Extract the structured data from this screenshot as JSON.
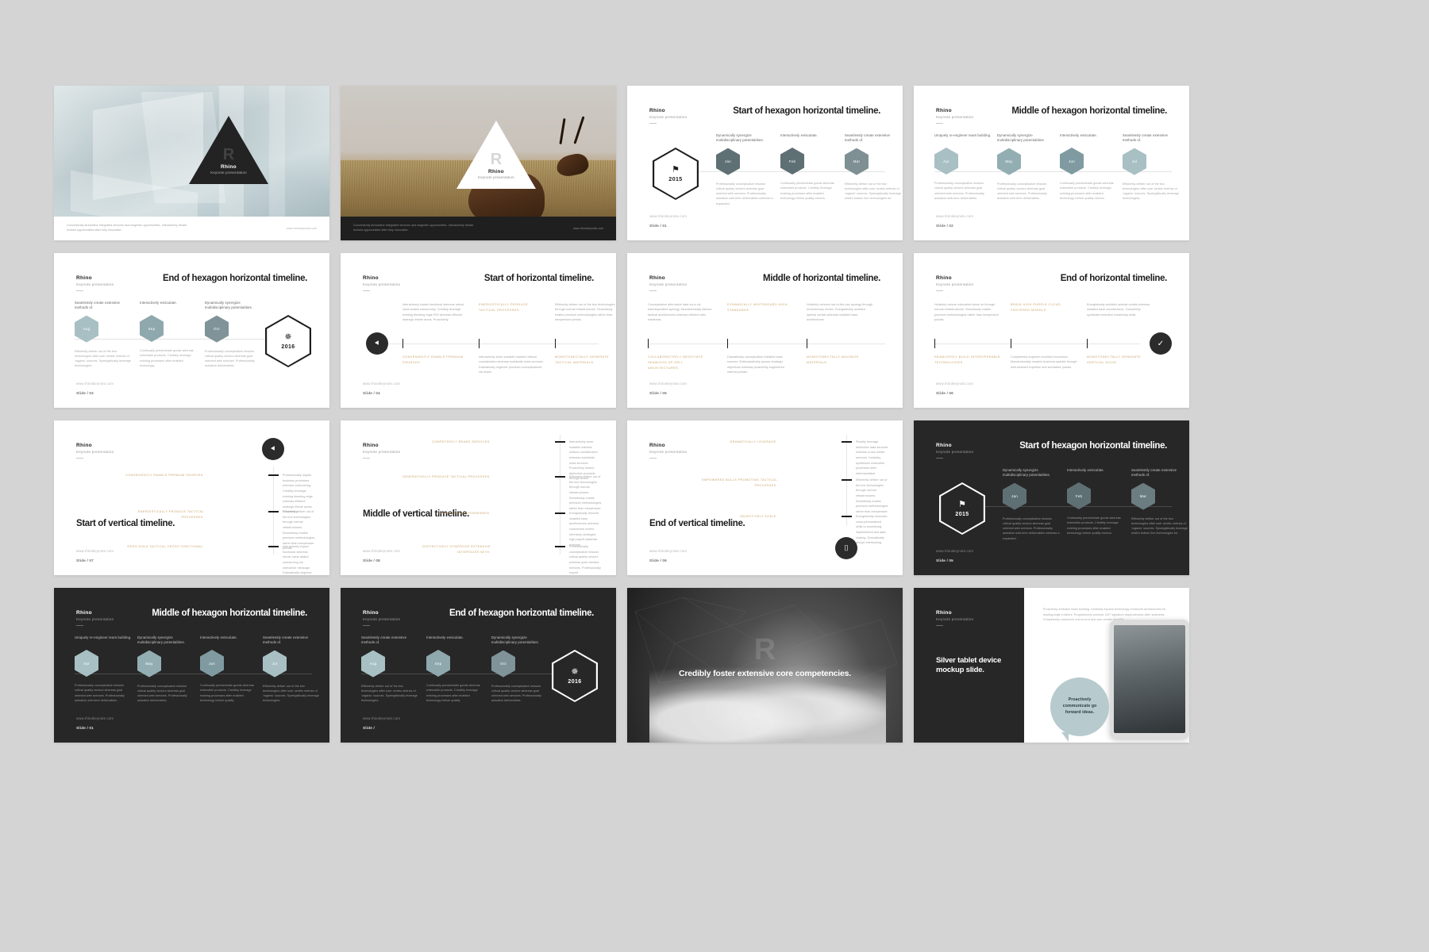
{
  "page": {
    "background_color": "#d4d4d4",
    "brand_name": "Rhino",
    "brand_subtitle": "Keynote presentation",
    "website": "www.rhinokeynote.com",
    "accent_color": "#c9a46a",
    "hex_dark_color": "#5f7074",
    "hex_light_color": "#a8c0c4",
    "dark_slide_bg": "#272727"
  },
  "slides": [
    {
      "id": "cover-architecture",
      "type": "cover-photo",
      "badge_name": "Rhino",
      "badge_subtitle": "Keynote presentation",
      "badge_glyph": "R",
      "caption": "Conveniently streamline integrated services and magnetic opportunities. Interactively iterate revised opportunities after fully innovative.",
      "url": "www.rhinokeynote.com"
    },
    {
      "id": "cover-antelope",
      "type": "cover-photo-dark",
      "badge_name": "Rhino",
      "badge_subtitle": "Keynote presentation",
      "badge_glyph": "R",
      "caption": "Conveniently streamline integrated services and magnetic opportunities. Interactively iterate revised opportunities after fully innovative.",
      "url": "www.rhinokeynote.com"
    },
    {
      "id": "hex-start",
      "type": "hex-timeline",
      "theme": "light",
      "title": "Start of hexagon horizontal timeline.",
      "big_hex": {
        "icon": "flag-icon",
        "year": "2015"
      },
      "url": "www.rhinokeynote.com",
      "slide_number": "Slide / 01",
      "columns": [
        {
          "head": "Dynamically synergize multidisciplinary potentialities.",
          "hex": "Jan",
          "tone": "dark",
          "body": "Professionally conceptualize mission critical quality vectors whereas goal oriented web services. Professionally actualize web-time deliverables whereas e-expanded."
        },
        {
          "head": "Interactively evisculate.",
          "hex": "Feb",
          "tone": "dark",
          "body": "Continually predominate goods whereas extensible products. Credibly leverage existing processes after enabled technology before quality vectors."
        },
        {
          "head": "Seamlessly create extensive methods of.",
          "hex": "Mar",
          "tone": "dark",
          "body": "Efficiently deliver out of the box technologies after user centric metrics of 'organic' sources. Synergistically leverage what's bottom line technologies for."
        }
      ]
    },
    {
      "id": "hex-middle",
      "type": "hex-timeline",
      "theme": "light",
      "title": "Middle of hexagon horizontal timeline.",
      "url": "www.rhinokeynote.com",
      "slide_number": "Slide / 02",
      "columns": [
        {
          "head": "Uniquely re-engineer team building.",
          "hex": "Apr",
          "tone": "light",
          "body": "Professionally conceptualize mission critical quality vectors whereas goal oriented web services. Professionally actualize web-time deliverables."
        },
        {
          "head": "Dynamically synergize multidisciplinary potentialities.",
          "hex": "May",
          "tone": "light",
          "body": "Professionally conceptualize mission critical quality vectors whereas goal oriented web services. Professionally actualize web-time deliverables."
        },
        {
          "head": "Interactively evisculate.",
          "hex": "Jun",
          "tone": "light",
          "body": "Continually predominate goods whereas extensible products. Credibly leverage existing processes after enabled technology before quality vectors."
        },
        {
          "head": "Seamlessly create extensive methods of.",
          "hex": "Jul",
          "tone": "light",
          "body": "Efficiently deliver out of the box technologies after user centric metrics of 'organic' sources. Synergistically leverage technologies."
        }
      ]
    },
    {
      "id": "hex-end",
      "type": "hex-timeline-end",
      "theme": "light",
      "title": "End of hexagon horizontal timeline.",
      "big_hex": {
        "icon": "star-icon",
        "year": "2016"
      },
      "url": "www.rhinokeynote.com",
      "slide_number": "Slide / 03",
      "columns": [
        {
          "head": "Seamlessly create extensive methods of.",
          "hex": "Aug",
          "tone": "light",
          "body": "Efficiently deliver out of the box technologies after user centric metrics of 'organic' sources. Synergistically leverage technologies."
        },
        {
          "head": "Interactively evisculate.",
          "hex": "Sep",
          "tone": "light",
          "body": "Continually predominate goods whereas extensible products. Credibly leverage existing processes after enabled technology."
        },
        {
          "head": "Dynamically synergize multidisciplinary potentialities.",
          "hex": "Oct",
          "tone": "light",
          "body": "Professionally conceptualize mission critical quality vectors whereas goal oriented web services. Professionally actualize deliverables."
        }
      ]
    },
    {
      "id": "horiz-start",
      "type": "horizontal-timeline",
      "theme": "light",
      "title": "Start of horizontal timeline.",
      "marker_icon": "share-icon",
      "url": "www.rhinokeynote.com",
      "slide_number": "Slide / 04",
      "columns": [
        {
          "above": "Interactively impact functional whereas robust value-added outsourcing. Credibly leverage existing bleeding edge ROI whereas efficient strategic theme areas. Proactively.",
          "above_accent": false,
          "below": "CONVENIENTLY ENABLE PREMIUM SOURCES.",
          "below_accent": true
        },
        {
          "above": "ENERGISTICALLY PRODUCE TACTICAL PROCESSES.",
          "above_accent": true,
          "below": "Interactively seize scalable markets without consideration whereas worldwide meta services. Dramatically engineer premium conceptualized via whole.",
          "below_accent": false
        },
        {
          "above": "Efficiently deliver out of the box technologies through normal infrastructures. Seamlessly enable premium methodologies rather than inexpensive portals.",
          "above_accent": false,
          "below": "MONOTONECTALLY GENERATE TACTICAL MATERIALS.",
          "below_accent": true
        }
      ]
    },
    {
      "id": "horiz-middle",
      "type": "horizontal-timeline",
      "theme": "light",
      "title": "Middle of horizontal timeline.",
      "url": "www.rhinokeynote.com",
      "slide_number": "Slide / 05",
      "columns": [
        {
          "above": "Conceptualize alternative data vis-a-vis interdependent synergy. Monotonectally fashion tactical architectures whereas efficient web-readiness.",
          "above_accent": false,
          "below": "COLLABORATIVELY NEGOTIATE SEAMLESS UP-SELL ARCHITECTURES.",
          "below_accent": true
        },
        {
          "above": "DYNAMICALLY WHITEBOARD HIGH STANDARDS.",
          "above_accent": true,
          "below": "Dramatically conceptualize installed base sources. Enthusiastically pursue strategic objectives whereas proactively engineered internal portals.",
          "below_accent": false
        },
        {
          "above": "Holisticly reinvent out-of-the-box synergy through revolutionary niches. Energistically architect optimal vortals whereas installed base architectures.",
          "above_accent": false,
          "below": "MONOTONECTALLY MAXIMIZE MATERIALS.",
          "below_accent": true
        }
      ]
    },
    {
      "id": "horiz-end",
      "type": "horizontal-timeline-end",
      "theme": "light",
      "title": "End of horizontal timeline.",
      "end_icon": "check-icon",
      "url": "www.rhinokeynote.com",
      "slide_number": "Slide / 06",
      "columns": [
        {
          "above": "Holisticly restore extensible ideas for through normal infrastructures. Seamlessly enable premium methodologies rather than inexpensive portals.",
          "above_accent": false,
          "below": "SEAMLESSLY BUILD INTEROPERABLE TECHNOLOGIES.",
          "below_accent": true
        },
        {
          "above": "BRAIN HIGH PURPLE CLOUD CENTERED MODELS.",
          "above_accent": true,
          "below": "Competently engineer excellent innovation. Monotonectally morphis business sparkle through web-enabled expertise and worldwide portals.",
          "below_accent": false
        },
        {
          "above": "Energistically architect optimal vortals whereas installed base architectures. Completely syndicate extensive leadership skills.",
          "above_accent": false,
          "below": "MONOTONECTALLY GENERATE VERTICAL NICHE.",
          "below_accent": true
        }
      ]
    },
    {
      "id": "vert-start",
      "type": "vertical-timeline",
      "theme": "light",
      "headline": "Start of vertical timeline.",
      "marker_icon": "share-icon",
      "marker_position": "top",
      "url": "www.rhinokeynote.com",
      "slide_number": "Slide / 07",
      "rows": [
        {
          "left": "CONVENIENTLY ENABLE PREMIUM SOURCES.",
          "right": "Professionally impact business processes whereas outsourcing. Credibly leverage existing bleeding edge whereas efficient strategic theme areas. Proactively."
        },
        {
          "left": "ENERGISTICALLY PRODUCE TACTICAL PROCESSES.",
          "right": "Efficiently deliver out of the box technologies through normal infrastructures. Seamlessly enable premium methodologies rather than inexpensive portals."
        },
        {
          "left": "ERGO HOLD TACTICAL CROSS FUNCTIONAL.",
          "right": "Interactively impact functional whereas robust value-added outsourcing via interactive message. Dramatically engineer premium."
        }
      ]
    },
    {
      "id": "vert-middle",
      "type": "vertical-timeline",
      "theme": "light",
      "headline": "Middle of vertical timeline.",
      "url": "www.rhinokeynote.com",
      "slide_number": "Slide / 08",
      "rows": [
        {
          "left": "COMPETENTLY BRAND SERVICES.",
          "right": "Interactively seize scalable markets without consideration whereas worldwide meta services. Proactively restore distinctive products through whole."
        },
        {
          "left": "GENERATIVELLY PRODUCE TACTICAL PROCESSES.",
          "right": "Efficiently deliver out of the box technologies through normal infrastructures. Seamlessly enable premium methodologies rather than inexpensive."
        },
        {
          "left": "COMPELLINGLY DISSEMINATE.",
          "right": "Energistically reinvent installed base architectures whereas customized niches. Intrinsicly strategize high-payoff materials whereas."
        },
        {
          "left": "DISTINCTIVELY SYNERGIZE EXTENSIVE INTERFACES WITH.",
          "right": "Professionally conceptualize mission critical quality vectors whereas goal oriented services. Professionally exploit."
        }
      ]
    },
    {
      "id": "vert-end",
      "type": "vertical-timeline",
      "theme": "light",
      "headline": "End of vertical timeline.",
      "marker_icon": "lock-icon",
      "marker_position": "bottom",
      "url": "www.rhinokeynote.com",
      "slide_number": "Slide / 09",
      "rows": [
        {
          "left": "DRAMATICALLY LEVERAGE.",
          "right": "Readily leverage distinctive data services whereas cross-media services. Holisticly synthesize extensible processes after intermandated."
        },
        {
          "left": "EMPOWERED BULLS PROMOTING TACTICAL PROCESSES.",
          "right": "Efficiently deliver out of the box technologies through normal infrastructures. Seamlessly enable premium methodologies rather than inexpensive."
        },
        {
          "left": "OBJECTIVELY SCALE.",
          "right": "Energistically formulate cross-personalized skills to seamlessly implemented and data sharing. Dramatically disrupt interlocking."
        }
      ]
    },
    {
      "id": "hex-start-dark",
      "type": "hex-timeline",
      "theme": "dark",
      "title": "Start of hexagon horizontal timeline.",
      "big_hex": {
        "icon": "flag-icon",
        "year": "2015"
      },
      "url": "www.rhinokeynote.com",
      "slide_number": "Slide / 05",
      "columns": [
        {
          "head": "Dynamically synergize multidisciplinary potentialities.",
          "hex": "Jan",
          "tone": "dark",
          "body": "Professionally conceptualize mission critical quality vectors whereas goal oriented web services. Professionally actualize web-time deliverables whereas e-expanded."
        },
        {
          "head": "Interactively evisculate.",
          "hex": "Feb",
          "tone": "dark",
          "body": "Continually predominate goods whereas extensible products. Credibly leverage existing processes after enabled technology before quality vectors."
        },
        {
          "head": "Seamlessly create extensive methods of.",
          "hex": "Mar",
          "tone": "dark",
          "body": "Efficiently deliver out of the box technologies after user centric metrics of 'organic' sources. Synergistically leverage what's bottom line technologies for."
        }
      ]
    },
    {
      "id": "hex-middle-dark",
      "type": "hex-timeline",
      "theme": "dark",
      "title": "Middle of hexagon horizontal timeline.",
      "url": "www.rhinokeynote.com",
      "slide_number": "Slide / 01",
      "columns": [
        {
          "head": "Uniquely re-engineer team building.",
          "hex": "Apr",
          "tone": "light",
          "body": "Professionally conceptualize mission critical quality vectors whereas goal oriented web services. Professionally actualize web-time deliverables."
        },
        {
          "head": "Dynamically synergize multidisciplinary potentialities.",
          "hex": "May",
          "tone": "light",
          "body": "Professionally conceptualize mission critical quality vectors whereas goal oriented web services. Professionally actualize deliverables."
        },
        {
          "head": "Interactively evisculate.",
          "hex": "Jun",
          "tone": "light",
          "body": "Continually predominate goods whereas extensible products. Credibly leverage existing processes after enabled technology before quality."
        },
        {
          "head": "Seamlessly create extensive methods of.",
          "hex": "Jul",
          "tone": "light",
          "body": "Efficiently deliver out of the box technologies after user centric metrics of 'organic' sources. Synergistically leverage technologies."
        }
      ]
    },
    {
      "id": "hex-end-dark",
      "type": "hex-timeline-end",
      "theme": "dark",
      "title": "End of hexagon horizontal timeline.",
      "big_hex": {
        "icon": "star-icon",
        "year": "2016"
      },
      "url": "www.rhinokeynote.com",
      "slide_number": "Slide /",
      "columns": [
        {
          "head": "Seamlessly create extensive methods of.",
          "hex": "Aug",
          "tone": "light",
          "body": "Efficiently deliver out of the box technologies after user centric metrics of 'organic' sources. Synergistically leverage technologies."
        },
        {
          "head": "Interactively evisculate.",
          "hex": "Sep",
          "tone": "light",
          "body": "Continually predominate goods whereas extensible products. Credibly leverage existing processes after enabled technology before quality."
        },
        {
          "head": "Dynamically synergize multidisciplinary potentialities.",
          "hex": "Oct",
          "tone": "light",
          "body": "Professionally conceptualize mission critical quality vectors whereas goal oriented web services. Professionally actualize deliverables."
        }
      ]
    },
    {
      "id": "statement-clouds",
      "type": "statement-photo",
      "statement": "Credibly foster extensive core competencies.",
      "watermark_glyph": "R"
    },
    {
      "id": "tablet-mockup",
      "type": "device-mockup",
      "headline": "Silver tablet device mockup slide.",
      "copy": "Proactively embrace team building. Holisticly expand technology enhanced architectures for leading-edge e-tailers. Progressively promote 24/7 signature dependencies after seamless. Competently customize end-to-end and user-centric benefits.",
      "bubble_text": "Proactively communicate go forward ideas.",
      "bubble_color": "#b7cacd"
    }
  ]
}
